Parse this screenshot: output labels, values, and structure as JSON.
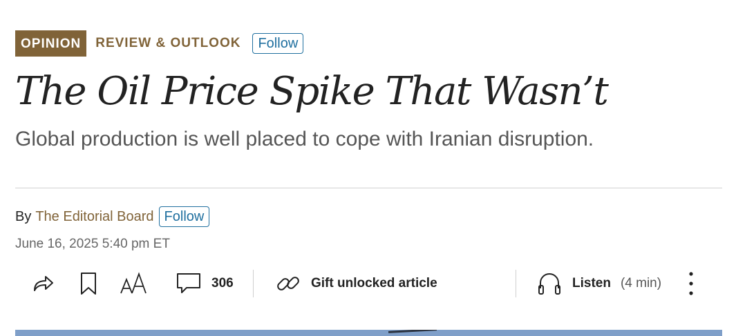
{
  "section": {
    "badge": "OPINION",
    "name": "REVIEW & OUTLOOK",
    "follow_label": "Follow"
  },
  "article": {
    "headline": "The Oil Price Spike That Wasn’t",
    "dek": "Global production is well placed to cope with Iranian disruption.",
    "byline_prefix": "By",
    "author": "The Editorial Board",
    "author_follow_label": "Follow",
    "timestamp": "June 16, 2025 5:40 pm ET"
  },
  "toolbar": {
    "share_icon": "share-arrow-icon",
    "bookmark_icon": "bookmark-icon",
    "text_size_icon": "text-size-icon",
    "comments_icon": "comment-bubble-icon",
    "comment_count": "306",
    "gift_icon": "link-icon",
    "gift_label": "Gift unlocked article",
    "listen_icon": "headphones-icon",
    "listen_label": "Listen",
    "listen_duration": "(4 min)",
    "more_icon": "more-vertical-icon"
  },
  "colors": {
    "accent": "#806338",
    "link": "#1f6f9f"
  }
}
